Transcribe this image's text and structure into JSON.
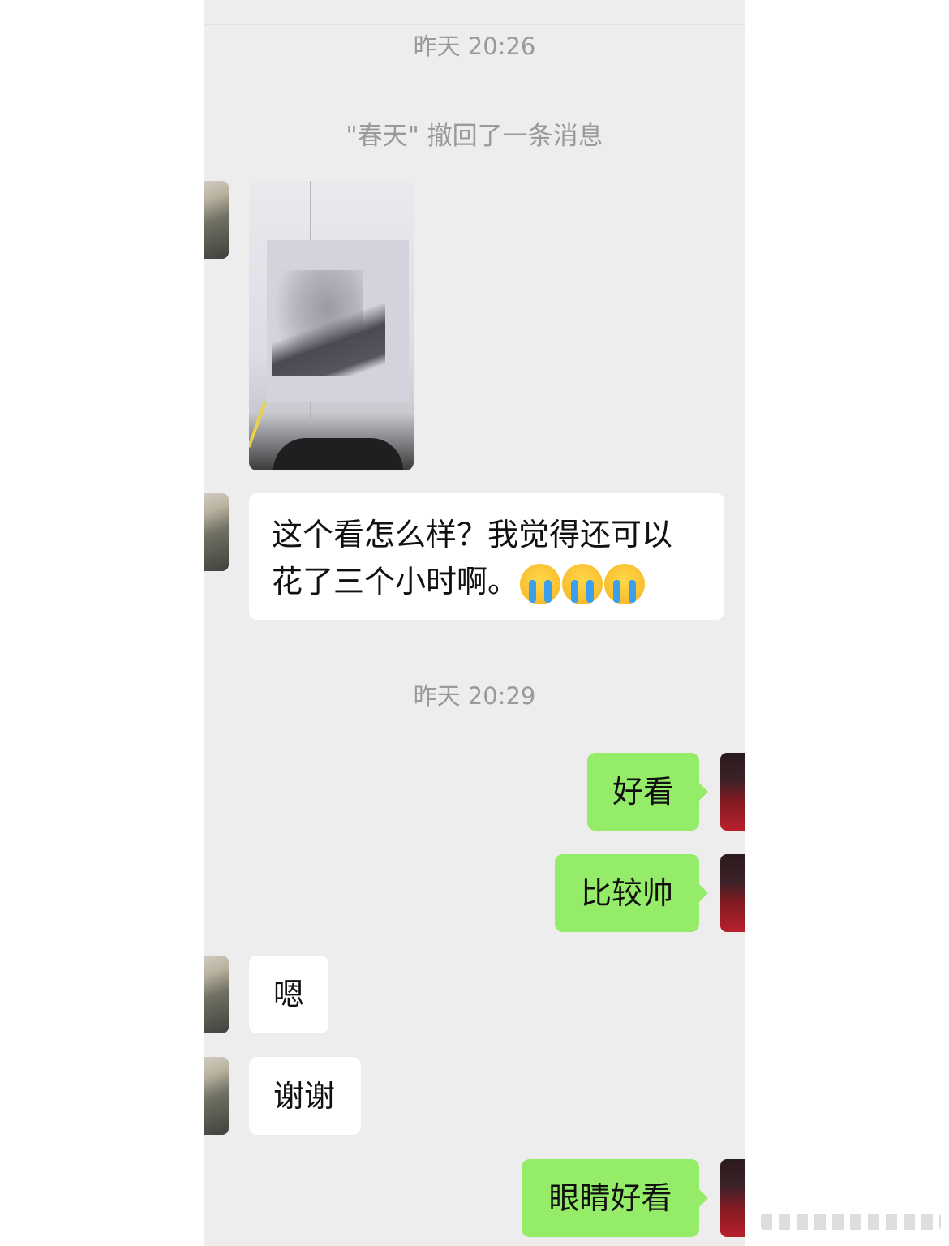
{
  "conversation": {
    "timestamps": [
      "昨天 20:26",
      "昨天 20:29"
    ],
    "recall_notice": "\"春天\" 撤回了一条消息",
    "messages": [
      {
        "side": "left",
        "type": "image",
        "content": "pencil portrait sketch photo"
      },
      {
        "side": "left",
        "type": "text",
        "lines": [
          "这个看怎么样？我觉得还可以",
          "花了三个小时啊。"
        ],
        "emoji": [
          "loudly-crying-face",
          "loudly-crying-face",
          "loudly-crying-face"
        ]
      },
      {
        "side": "right",
        "type": "text",
        "text": "好看"
      },
      {
        "side": "right",
        "type": "text",
        "text": "比较帅"
      },
      {
        "side": "left",
        "type": "text",
        "text": "嗯"
      },
      {
        "side": "left",
        "type": "text",
        "text": "谢谢"
      },
      {
        "side": "right",
        "type": "text",
        "text": "眼睛好看"
      }
    ]
  },
  "colors": {
    "chat_background": "#ededed",
    "incoming_bubble": "#ffffff",
    "outgoing_bubble": "#95ec69",
    "system_text": "#9a9a9a"
  }
}
